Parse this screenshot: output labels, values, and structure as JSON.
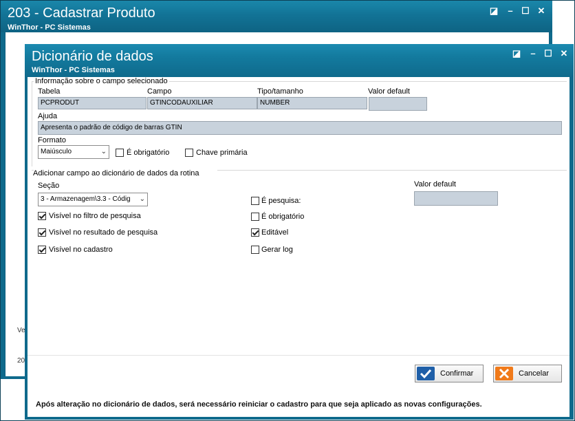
{
  "background_window": {
    "title": "203 - Cadastrar  Produto",
    "subtitle": "WinThor - PC Sistemas",
    "fragment_1": "Ve",
    "fragment_2": "20"
  },
  "dialog": {
    "title": "Dicionário de dados",
    "subtitle": "WinThor - PC Sistemas"
  },
  "field_info": {
    "group_label": "Informação sobre o campo selecionado",
    "tabela_label": "Tabela",
    "tabela_value": "PCPRODUT",
    "campo_label": "Campo",
    "campo_value": "GTINCODAUXILIAR",
    "tipo_label": "Tipo/tamanho",
    "tipo_value": "NUMBER",
    "valor_default_label": "Valor default",
    "valor_default_value": "",
    "ajuda_label": "Ajuda",
    "ajuda_value": "Apresenta o padrão de código de barras GTIN",
    "formato_label": "Formato",
    "formato_value": "Maiúsculo",
    "obrigatorio_label": "É obrigatório",
    "obrigatorio_checked": false,
    "chave_label": "Chave primária",
    "chave_checked": false
  },
  "add_field": {
    "group_label": "Adicionar campo ao dicionário de dados da rotina",
    "secao_label": "Seção",
    "secao_value": "3 - Armazenagem\\3.3 - Códig",
    "valor_default_label": "Valor default",
    "valor_default_value": "",
    "checkboxes": [
      {
        "label": "Visível no filtro de pesquisa",
        "checked": true
      },
      {
        "label": "Visível no resultado de pesquisa",
        "checked": true
      },
      {
        "label": "Visível no cadastro",
        "checked": true
      },
      {
        "label": "É pesquisa:",
        "checked": false
      },
      {
        "label": "É obrigatório",
        "checked": false
      },
      {
        "label": "Editável",
        "checked": true
      },
      {
        "label": "Gerar log",
        "checked": false
      }
    ]
  },
  "buttons": {
    "confirm_label": "Confirmar",
    "cancel_label": "Cancelar"
  },
  "footer_note": "Após alteração no dicionário de dados, será necessário reiniciar o cadastro para que seja aplicado as novas configurações.",
  "colors": {
    "titlebar": "#0f6a8c",
    "readonly_field": "#c8d2dc",
    "confirm_icon": "#1f5fa8",
    "cancel_icon": "#f07a1a"
  }
}
